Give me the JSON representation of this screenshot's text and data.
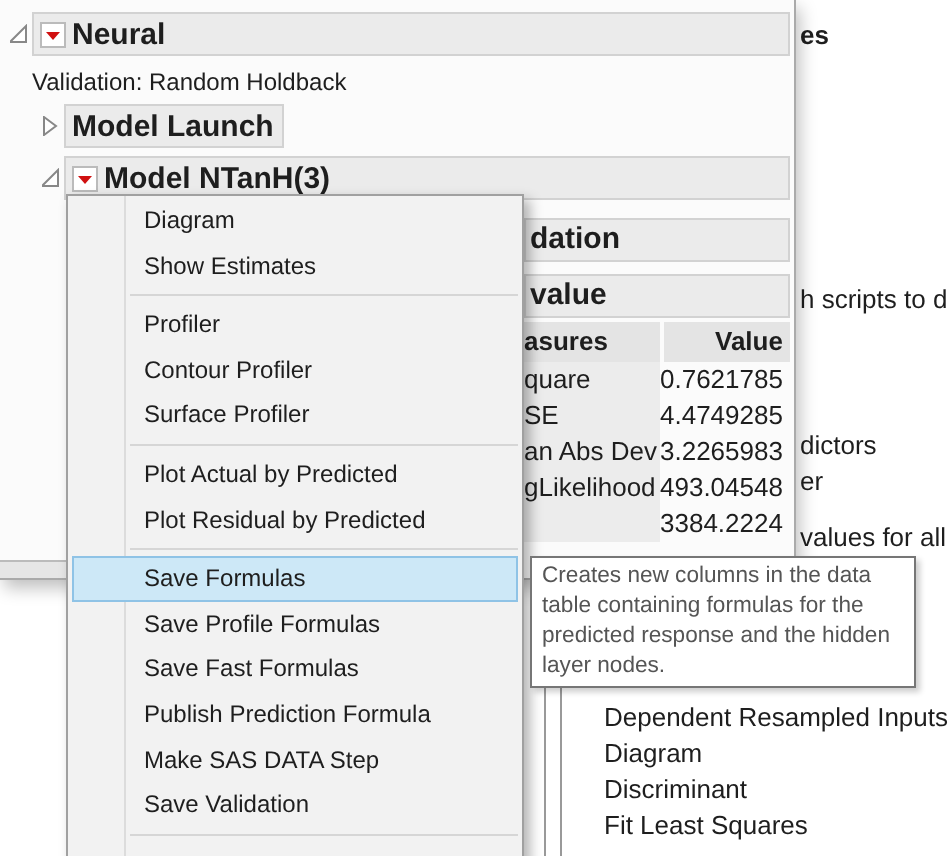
{
  "background_page": {
    "fragments": [
      "es",
      "h scripts to d",
      "dictors",
      "er",
      "values for all"
    ],
    "list": [
      "Dependent Resampled Inputs",
      "Diagram",
      "Discriminant",
      "Fit Least Squares"
    ]
  },
  "report": {
    "title": "Neural",
    "expanded": true,
    "menu": true,
    "validation": "Validation: Random Holdback",
    "outlines": [
      {
        "title": "Model Launch",
        "expanded": false,
        "menu": false
      },
      {
        "title": "Model NTanH(3)",
        "expanded": true,
        "menu": true
      }
    ],
    "sections": [
      {
        "title": "dation"
      },
      {
        "title": "value"
      }
    ],
    "table": {
      "columns": [
        "asures",
        "Value"
      ],
      "rows": [
        [
          "quare",
          "0.7621785"
        ],
        [
          "SE",
          "4.4749285"
        ],
        [
          "an Abs Dev",
          "3.2265983"
        ],
        [
          "gLikelihood",
          "493.04548"
        ],
        [
          "",
          "3384.2224"
        ]
      ]
    }
  },
  "menu": {
    "groups": [
      [
        {
          "label": "Diagram",
          "selected": false
        },
        {
          "label": "Show Estimates",
          "selected": false
        }
      ],
      [
        {
          "label": "Profiler",
          "selected": false
        },
        {
          "label": "Contour Profiler",
          "selected": false
        },
        {
          "label": "Surface Profiler",
          "selected": false
        }
      ],
      [
        {
          "label": "Plot Actual by Predicted",
          "selected": false
        },
        {
          "label": "Plot Residual by Predicted",
          "selected": false
        }
      ],
      [
        {
          "label": "Save Formulas",
          "selected": true
        },
        {
          "label": "Save Profile Formulas",
          "selected": false
        },
        {
          "label": "Save Fast Formulas",
          "selected": false
        },
        {
          "label": "Publish Prediction Formula",
          "selected": false
        },
        {
          "label": "Make SAS DATA Step",
          "selected": false
        },
        {
          "label": "Save Validation",
          "selected": false
        }
      ]
    ]
  },
  "tooltip": {
    "text": "Creates new columns in the data table containing formulas for the predicted response and the hidden layer nodes."
  }
}
